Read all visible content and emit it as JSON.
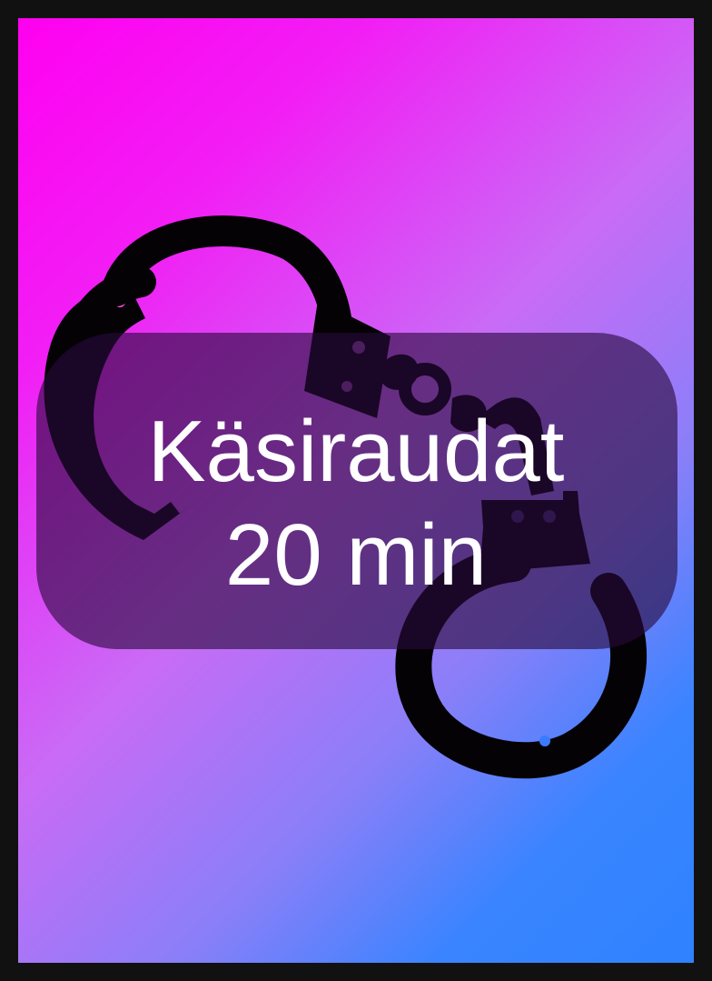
{
  "card": {
    "title": "Käsiraudat",
    "duration": "20 min",
    "icon": "handcuffs-icon"
  },
  "colors": {
    "gradient_start": "#ff00f0",
    "gradient_end": "#2f82ff",
    "frame": "#111111",
    "text": "#ffffff"
  }
}
